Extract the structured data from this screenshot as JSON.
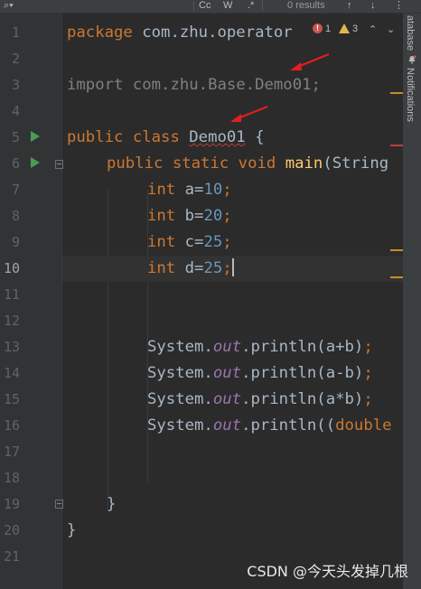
{
  "search_bar": {
    "case_label": "Cc",
    "word_label": "W",
    "regex_label": ".*",
    "results": "0 results"
  },
  "right_strip": {
    "database_label": "atabase",
    "notifications_label": "Notifications"
  },
  "inspections": {
    "errors": "1",
    "warnings": "3"
  },
  "code_lines": [
    {
      "n": "1"
    },
    {
      "n": "2"
    },
    {
      "n": "3"
    },
    {
      "n": "4"
    },
    {
      "n": "5"
    },
    {
      "n": "6"
    },
    {
      "n": "7"
    },
    {
      "n": "8"
    },
    {
      "n": "9"
    },
    {
      "n": "10"
    },
    {
      "n": "11"
    },
    {
      "n": "12"
    },
    {
      "n": "13"
    },
    {
      "n": "14"
    },
    {
      "n": "15"
    },
    {
      "n": "16"
    },
    {
      "n": "17"
    },
    {
      "n": "18"
    },
    {
      "n": "19"
    },
    {
      "n": "20"
    },
    {
      "n": "21"
    }
  ],
  "code": {
    "l1_kw": "package",
    "l1_rest": " com.zhu.operator",
    "l3_text": "import com.zhu.Base.Demo01;",
    "l5_kw": "public class ",
    "l5_name": "Demo01",
    "l5_rest": " {",
    "l6_kw": "public static void ",
    "l6_fn": "main",
    "l6_rest": "(String",
    "l7_kw": "int ",
    "l7_var": "a=",
    "l7_num": "10",
    "l7_end": ";",
    "l8_kw": "int ",
    "l8_var": "b=",
    "l8_num": "20",
    "l8_end": ";",
    "l9_kw": "int ",
    "l9_var": "c=",
    "l9_num": "25",
    "l9_end": ";",
    "l10_kw": "int ",
    "l10_var": "d=",
    "l10_num": "25",
    "l10_end": ";",
    "l13_a": "System.",
    "l13_f": "out",
    "l13_b": ".println(a+b)",
    "l13_e": ";",
    "l14_a": "System.",
    "l14_f": "out",
    "l14_b": ".println(a-b)",
    "l14_e": ";",
    "l15_a": "System.",
    "l15_f": "out",
    "l15_b": ".println(a*b)",
    "l15_e": ";",
    "l16_a": "System.",
    "l16_f": "out",
    "l16_b": ".println((",
    "l16_kw": "double",
    "l19_text": "}",
    "l20_text": "}"
  },
  "watermark": "CSDN @今天头发掉几根",
  "colors": {
    "background": "#2b2b2b",
    "keyword": "#cc7832",
    "number": "#6897bb",
    "method": "#ffc66d",
    "field": "#9876aa",
    "text": "#a9b7c6",
    "run_icon": "#499c54",
    "annotation_arrow": "#e02020"
  }
}
